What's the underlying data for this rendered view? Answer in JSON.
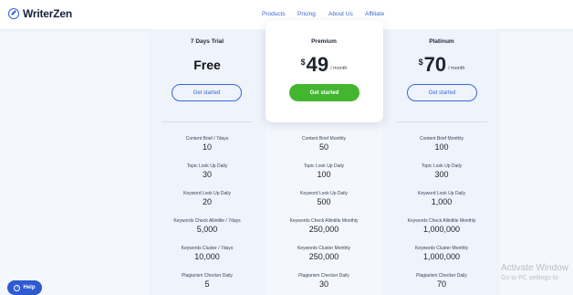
{
  "brand": {
    "name": "WriterZen"
  },
  "nav": {
    "items": [
      "Products",
      "Pricing",
      "About Us",
      "Affiliate"
    ]
  },
  "plans": [
    {
      "name": "7 Days Trial",
      "price_text": "Free",
      "cta": "Get started",
      "highlight": false
    },
    {
      "name": "Premium",
      "currency": "$",
      "price": "49",
      "period": "/ month",
      "cta": "Get started",
      "highlight": true
    },
    {
      "name": "Platinum",
      "currency": "$",
      "price": "70",
      "period": "/ month",
      "cta": "Get started",
      "highlight": false
    }
  ],
  "features": [
    {
      "free_label": "Content Brief / 7days",
      "free_value": "10",
      "premium_label": "Content Brief Monthly",
      "premium_value": "50",
      "platinum_label": "Content Brief Monthly",
      "platinum_value": "100"
    },
    {
      "free_label": "Topic Look Up Daily",
      "free_value": "30",
      "premium_label": "Topic Look Up Daily",
      "premium_value": "100",
      "platinum_label": "Topic Look Up Daily",
      "platinum_value": "300"
    },
    {
      "free_label": "Keyword Look Up Daily",
      "free_value": "20",
      "premium_label": "Keyword Look Up Daily",
      "premium_value": "500",
      "platinum_label": "Keyword Look Up Daily",
      "platinum_value": "1,000"
    },
    {
      "free_label": "Keywords Check Allintitle / 7days",
      "free_value": "5,000",
      "premium_label": "Keywords Check Allintitle Monthly",
      "premium_value": "250,000",
      "platinum_label": "Keywords Check Allintitle Monthly",
      "platinum_value": "1,000,000"
    },
    {
      "free_label": "Keywords Cluster / 7days",
      "free_value": "10,000",
      "premium_label": "Keywords Cluster Monthly",
      "premium_value": "250,000",
      "platinum_label": "Keywords Cluster Monthly",
      "platinum_value": "1,000,000"
    },
    {
      "free_label": "Plagiarism Checker Daily",
      "free_value": "5",
      "premium_label": "Plagiarism Checker Daily",
      "premium_value": "30",
      "platinum_label": "Plagiarism Checker Daily",
      "platinum_value": "70"
    }
  ],
  "help": {
    "label": "Help"
  },
  "watermark": {
    "title": "Activate Window",
    "subtitle": "Go to PC settings to"
  },
  "colors": {
    "accent": "#3a66d6",
    "cta_green": "#43b52f",
    "column_bg": "#eef3fc"
  }
}
